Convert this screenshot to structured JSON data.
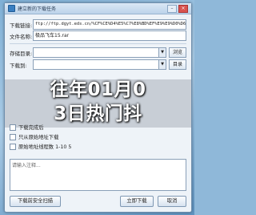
{
  "window": {
    "title": "建立新的下载任务"
  },
  "form": {
    "url_label": "下载链接:",
    "url_value": "ftp://ftp.dgyt.eds.cn/%CF%CE%D4%E5%C7%E8%BD%EF%E9%E9%D0%D6",
    "filename_label": "文件名称:",
    "filename_value": "极品飞车15.rar",
    "category_label": "存储目录:",
    "category_value": "",
    "browse_label": "浏览",
    "dir_label": "下载到:",
    "dir_value": "",
    "dir_button": "目录"
  },
  "options": {
    "opt1": "下载完成后",
    "opt2": "只从原始地址下载",
    "opt3": "原始地址线程数 1-10 5"
  },
  "overlay": {
    "line1": "往年01月0",
    "line2": "3日热门抖"
  },
  "comment": {
    "placeholder": "请输入注释..."
  },
  "footer": {
    "primary": "下载前安全扫描",
    "now": "立即下载",
    "cancel": "取消"
  }
}
